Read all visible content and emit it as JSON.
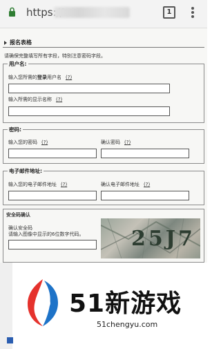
{
  "browser": {
    "url_scheme": "https://",
    "tab_count": "1"
  },
  "form": {
    "section_title": "报名表格",
    "notice": "请确保完整填写所有字段，特别注意密码字段。",
    "help_label": "(?)",
    "username": {
      "legend": "用户名:",
      "login_label_prefix": "输入您所需的",
      "login_label_bold": "登录",
      "login_label_suffix": "用户名",
      "display_label": "输入所需的显示名称"
    },
    "password": {
      "legend": "密码:",
      "enter_label": "输入您的密码",
      "confirm_label": "确认密码"
    },
    "email": {
      "legend": "电子邮件地址:",
      "enter_label": "输入您的电子邮件地址",
      "confirm_label": "确认电子邮件地址"
    },
    "captcha": {
      "legend": "安全码确认",
      "confirm_label": "确认安全码",
      "instruction": "请输入图像中显示的6位数字代码。",
      "image_text": "25J7",
      "image_alt": "安全码图像"
    }
  },
  "watermark": {
    "brand": "51新游戏",
    "domain": "51chengyu.com",
    "colors": {
      "red": "#e5322d",
      "blue": "#1e73c8"
    }
  }
}
